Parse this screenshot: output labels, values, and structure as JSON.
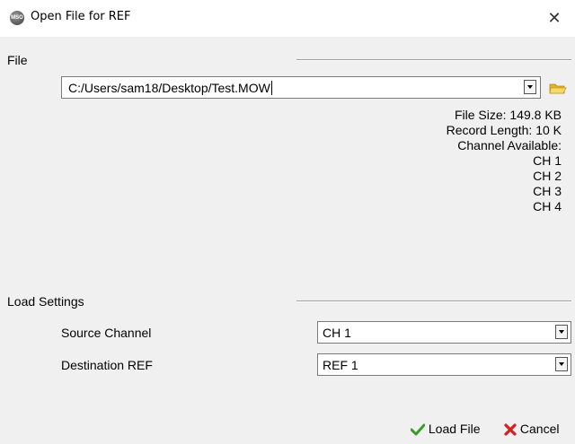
{
  "window": {
    "title": "Open File for REF",
    "icon_label": "MSO",
    "close_glyph": "✕"
  },
  "file_section": {
    "label": "File",
    "path_value": "C:/Users/sam18/Desktop/Test.MOW",
    "info": [
      "File Size: 149.8 KB",
      "Record Length: 10 K",
      "Channel Available:",
      "CH 1",
      "CH 2",
      "CH 3",
      "CH 4"
    ]
  },
  "load_settings": {
    "label": "Load Settings",
    "source_channel": {
      "label": "Source Channel",
      "value": "CH 1"
    },
    "destination_ref": {
      "label": "Destination REF",
      "value": "REF 1"
    }
  },
  "buttons": {
    "load_file": "Load File",
    "cancel": "Cancel"
  },
  "colors": {
    "dialog_bg": "#f0f0f0",
    "titlebar_bg": "#ffffff",
    "check_green": "#3a9a2a",
    "cancel_red": "#d42020",
    "folder_yellow": "#f2c94c"
  }
}
